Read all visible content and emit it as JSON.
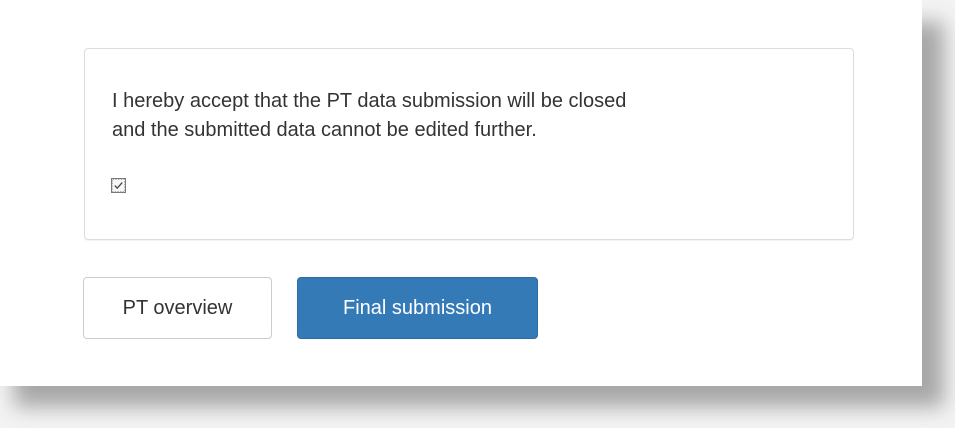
{
  "agreement": {
    "statement_line1": "I hereby accept that the PT data submission will be closed",
    "statement_line2": "and the submitted data cannot be edited further.",
    "checkbox_checked": true
  },
  "actions": {
    "overview_label": "PT overview",
    "submit_label": "Final submission"
  },
  "colors": {
    "primary": "#337ab7",
    "text": "#333333",
    "border": "#dddddd"
  }
}
